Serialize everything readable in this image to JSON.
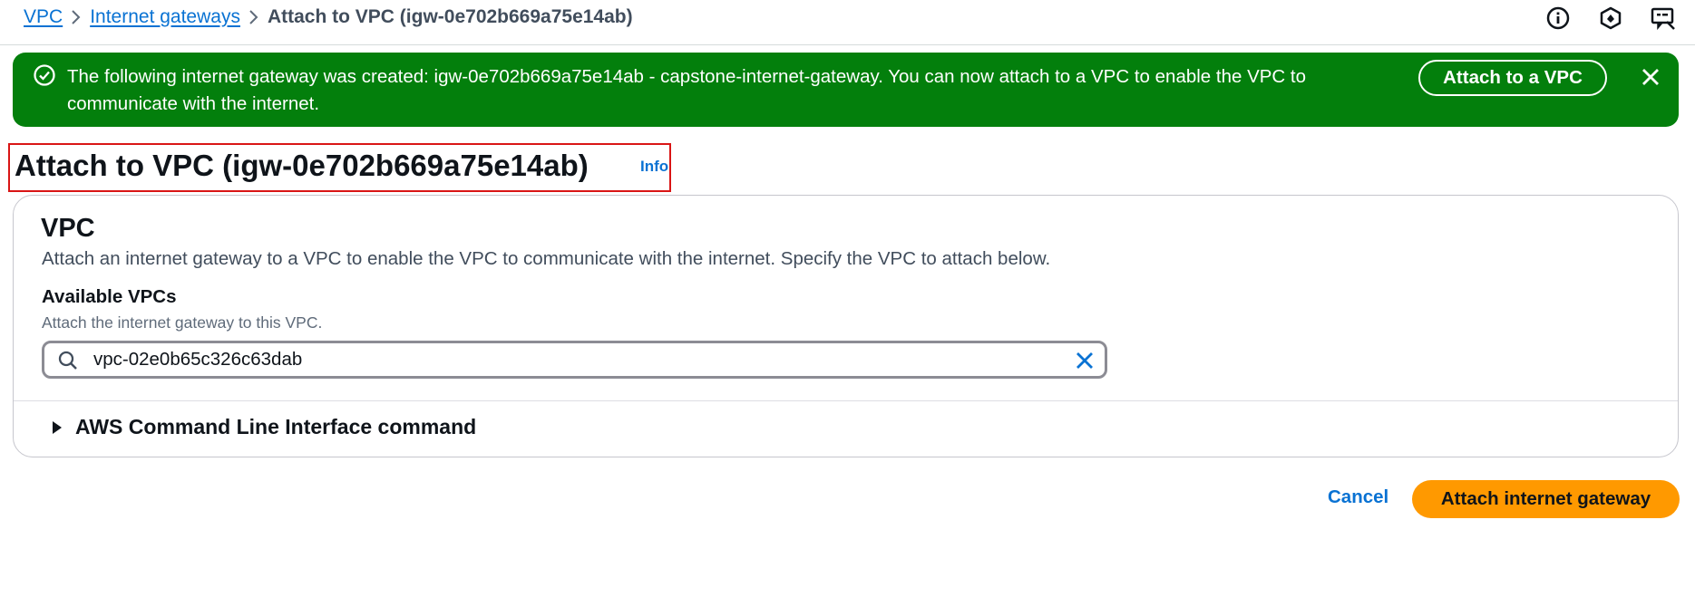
{
  "breadcrumb": {
    "items": [
      {
        "label": "VPC"
      },
      {
        "label": "Internet gateways"
      },
      {
        "label": "Attach to VPC (igw-0e702b669a75e14ab)"
      }
    ]
  },
  "top_icons": [
    "info-circle-icon",
    "settings-hexagon-icon",
    "feedback-screen-icon"
  ],
  "flash": {
    "message": "The following internet gateway was created: igw-0e702b669a75e14ab - capstone-internet-gateway. You can now attach to a VPC to enable the VPC to communicate with the internet.",
    "action_label": "Attach to a VPC",
    "color": "#037f0c"
  },
  "header": {
    "title": "Attach to VPC (igw-0e702b669a75e14ab)",
    "info_label": "Info"
  },
  "vpc_section": {
    "title": "VPC",
    "description": "Attach an internet gateway to a VPC to enable the VPC to communicate with the internet. Specify the VPC to attach below.",
    "field_label": "Available VPCs",
    "field_description": "Attach the internet gateway to this VPC.",
    "field_value": "vpc-02e0b65c326c63dab",
    "cli_expander_label": "AWS Command Line Interface command"
  },
  "footer": {
    "cancel_label": "Cancel",
    "submit_label": "Attach internet gateway",
    "submit_color": "#ff9900"
  }
}
